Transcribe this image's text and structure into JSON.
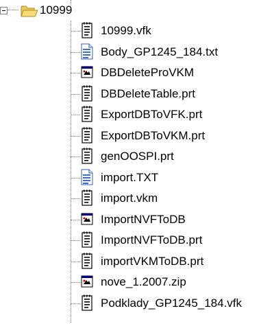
{
  "tree": {
    "root": {
      "label": "10999",
      "icon": "folder-open-icon"
    },
    "items": [
      {
        "label": "10999.vfk",
        "icon": "text-file-icon"
      },
      {
        "label": "Body_GP1245_184.txt",
        "icon": "notepad-file-icon"
      },
      {
        "label": "DBDeleteProVKM",
        "icon": "batch-file-icon"
      },
      {
        "label": "DBDeleteTable.prt",
        "icon": "text-file-icon"
      },
      {
        "label": "ExportDBToVFK.prt",
        "icon": "text-file-icon"
      },
      {
        "label": "ExportDBToVKM.prt",
        "icon": "text-file-icon"
      },
      {
        "label": "genOOSPI.prt",
        "icon": "text-file-icon"
      },
      {
        "label": "import.TXT",
        "icon": "notepad-file-icon"
      },
      {
        "label": "import.vkm",
        "icon": "text-file-icon"
      },
      {
        "label": "ImportNVFToDB",
        "icon": "batch-file-icon"
      },
      {
        "label": "ImportNVFToDB.prt",
        "icon": "text-file-icon"
      },
      {
        "label": "importVKMToDB.prt",
        "icon": "text-file-icon"
      },
      {
        "label": "nove_1.2007.zip",
        "icon": "batch-file-icon"
      },
      {
        "label": "Podklady_GP1245_184.vfk",
        "icon": "text-file-icon"
      }
    ]
  },
  "colors": {
    "folder": "#f5d76a",
    "folder_dark": "#c9a22b",
    "notepad": "#3b6ed1",
    "line": "#808080"
  }
}
